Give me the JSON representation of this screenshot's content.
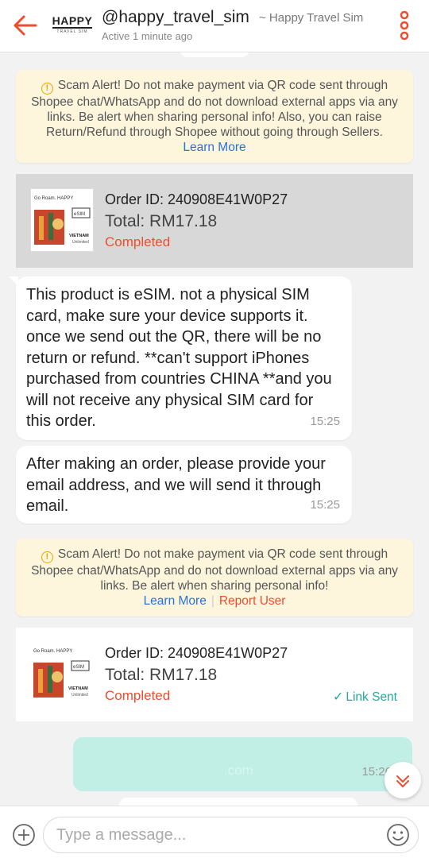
{
  "header": {
    "logo_text": "HAPPY",
    "logo_sub": "TRAVEL SIM",
    "shop_handle": "@happy_travel_sim",
    "shop_name": "~ Happy Travel Sim",
    "status": "Active 1 minute ago",
    "icons": {
      "back": "back-arrow-icon",
      "more": "more-vertical-icon"
    }
  },
  "scam_alerts": [
    {
      "text": "Scam Alert! Do not make payment via QR code sent through Shopee chat/WhatsApp and do not download external apps via any links. Be alert when sharing personal info! Also, you can raise Return/Refund through Shopee without going through Sellers.",
      "learn_more": "Learn More"
    },
    {
      "text": "Scam Alert! Do not make payment via QR code sent through Shopee chat/WhatsApp and do not download external apps via any links. Be alert when sharing personal info!",
      "learn_more": "Learn More",
      "report_user": "Report User"
    }
  ],
  "orders": [
    {
      "order_id": "Order ID: 240908E41W0P27",
      "total": "Total: RM17.18",
      "status": "Completed",
      "thumb_text": {
        "brand": "Go Roam. HAPPY",
        "esim": "eSIM",
        "country": "VIETNAM",
        "plan": "Unlimited"
      }
    },
    {
      "order_id": "Order ID: 240908E41W0P27",
      "total": "Total: RM17.18",
      "status": "Completed",
      "link_sent": "Link Sent",
      "thumb_text": {
        "brand": "Go Roam. HAPPY",
        "esim": "eSIM",
        "country": "VIETNAM",
        "plan": "Unlimited"
      }
    }
  ],
  "messages": [
    {
      "text": "This product is eSIM. not a physical SIM card, make sure your device supports it. once we send out the QR, there will be no return or refund. **can't support iPhones purchased from countries CHINA **and you will not receive any physical SIM card for this order.",
      "time": "15:25"
    },
    {
      "text": "After making an order, please provide your email address, and we will send it through email.",
      "time": "15:25"
    }
  ],
  "outgoing": {
    "blurred_text": ".com",
    "time": "15:26"
  },
  "input": {
    "placeholder": "Type a message..."
  },
  "colors": {
    "accent": "#ee4d2d",
    "link": "#2673dd",
    "success": "#26aa99",
    "alert_bg": "#fdf5dc",
    "outgoing_bg": "#c2efe5"
  }
}
